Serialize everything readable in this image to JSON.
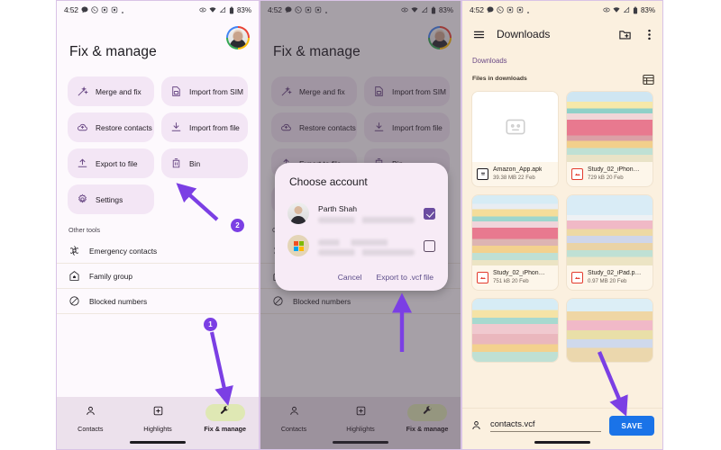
{
  "statusbar": {
    "time": "4:52",
    "icons": [
      "chat-icon",
      "whatsapp-icon",
      "app-icon",
      "app-icon",
      "dot-icon"
    ],
    "right_icons": [
      "vpn-icon",
      "wifi-icon",
      "signal-icon",
      "battery-icon"
    ],
    "battery": "83%"
  },
  "panel1": {
    "title": "Fix & manage",
    "chips": [
      {
        "label": "Merge and fix",
        "icon": "magic-wand-icon"
      },
      {
        "label": "Import from SIM",
        "icon": "sim-card-icon"
      },
      {
        "label": "Restore contacts",
        "icon": "cloud-restore-icon"
      },
      {
        "label": "Import from file",
        "icon": "download-icon"
      },
      {
        "label": "Export to file",
        "icon": "upload-icon"
      },
      {
        "label": "Bin",
        "icon": "trash-icon"
      },
      {
        "label": "Settings",
        "icon": "gear-icon"
      }
    ],
    "other_tools_label": "Other tools",
    "tools": [
      {
        "label": "Emergency contacts",
        "icon": "emergency-icon"
      },
      {
        "label": "Family group",
        "icon": "family-home-icon"
      },
      {
        "label": "Blocked numbers",
        "icon": "blocked-icon"
      }
    ],
    "nav": [
      {
        "label": "Contacts",
        "icon": "person-icon",
        "active": false
      },
      {
        "label": "Highlights",
        "icon": "highlights-icon",
        "active": false
      },
      {
        "label": "Fix & manage",
        "icon": "wrench-icon",
        "active": true
      }
    ]
  },
  "panel2": {
    "dialog": {
      "title": "Choose account",
      "accounts": [
        {
          "name": "Parth Shah",
          "avatar": "user-photo-avatar",
          "checked": true
        },
        {
          "name": "",
          "avatar": "microsoft-account-avatar",
          "checked": false
        }
      ],
      "cancel_label": "Cancel",
      "confirm_label": "Export to .vcf file"
    }
  },
  "panel3": {
    "appbar": {
      "menu_icon": "hamburger-menu-icon",
      "title": "Downloads",
      "new_folder_icon": "new-folder-icon",
      "overflow_icon": "more-vert-icon"
    },
    "breadcrumb": "Downloads",
    "subheader": "Files in downloads",
    "view_toggle_icon": "list-view-icon",
    "files": [
      {
        "name": "Amazon_App.apk",
        "size": "39.38 MB",
        "date": "22 Feb",
        "type": "apk"
      },
      {
        "name": "Study_02_iPhon…",
        "size": "729 kB",
        "date": "20 Feb",
        "type": "img"
      },
      {
        "name": "Study_02_iPhon…",
        "size": "751 kB",
        "date": "20 Feb",
        "type": "img"
      },
      {
        "name": "Study_02_iPad.p…",
        "size": "0.97 MB",
        "date": "20 Feb",
        "type": "img"
      },
      {
        "name": "",
        "size": "",
        "date": "",
        "type": "img"
      },
      {
        "name": "",
        "size": "",
        "date": "",
        "type": "img"
      }
    ],
    "savebar": {
      "account_icon": "person-icon",
      "filename": "contacts.vcf",
      "save_label": "SAVE"
    }
  },
  "annotations": {
    "badge1": "1",
    "badge2": "2",
    "arrow_color": "#7b3fe4"
  }
}
